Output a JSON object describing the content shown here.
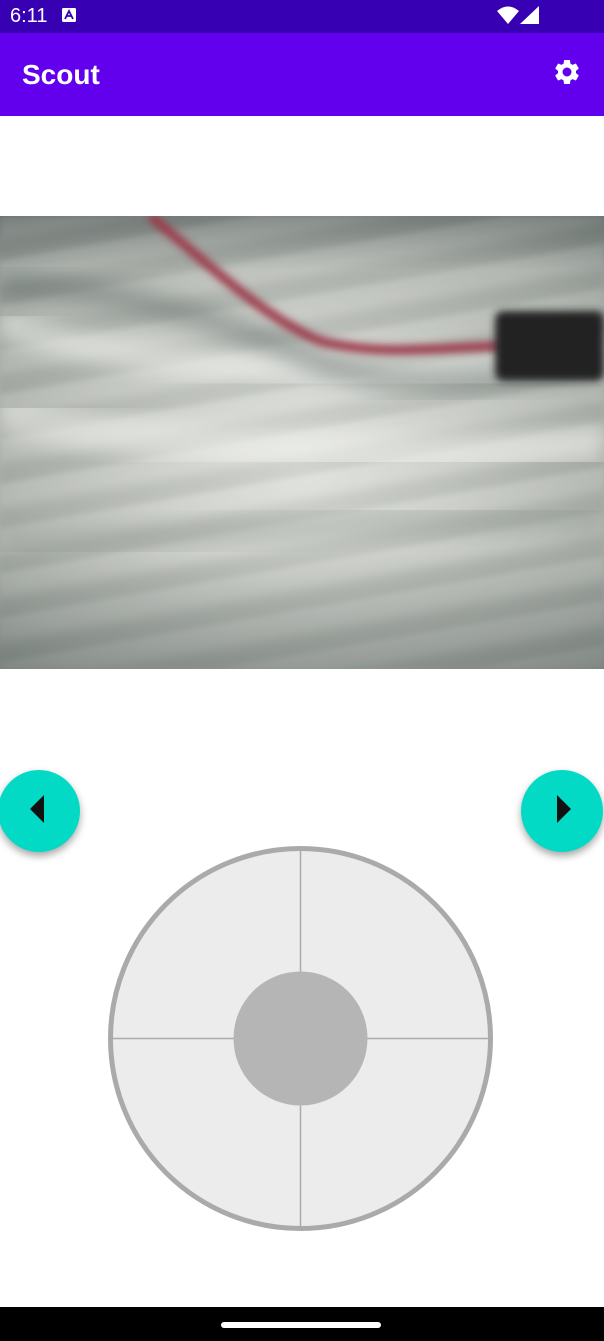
{
  "status_bar": {
    "time": "6:11",
    "notification_icon": "a-icon",
    "wifi_icon": "wifi-icon",
    "signal_icon": "signal-icon"
  },
  "app_bar": {
    "title": "Scout",
    "settings_icon": "gear-icon"
  },
  "camera": {
    "feed": "camera-feed-image"
  },
  "controls": {
    "left_icon": "arrow-left-icon",
    "right_icon": "arrow-right-icon",
    "joystick_icon": "joystick"
  },
  "colors": {
    "status_bar": "#3700b3",
    "app_bar": "#6200ee",
    "accent": "#03dac5",
    "joystick_base": "#ececec",
    "joystick_ring": "#aaaaaa",
    "joystick_knob": "#b5b5b5"
  }
}
